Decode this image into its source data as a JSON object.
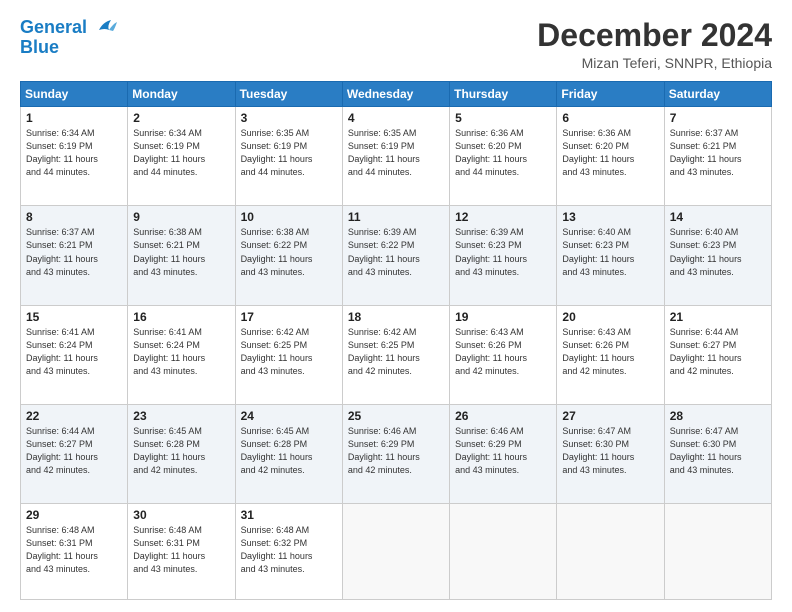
{
  "header": {
    "logo_line1": "General",
    "logo_line2": "Blue",
    "month": "December 2024",
    "location": "Mizan Teferi, SNNPR, Ethiopia"
  },
  "days_of_week": [
    "Sunday",
    "Monday",
    "Tuesday",
    "Wednesday",
    "Thursday",
    "Friday",
    "Saturday"
  ],
  "weeks": [
    [
      {
        "day": "1",
        "info": "Sunrise: 6:34 AM\nSunset: 6:19 PM\nDaylight: 11 hours\nand 44 minutes."
      },
      {
        "day": "2",
        "info": "Sunrise: 6:34 AM\nSunset: 6:19 PM\nDaylight: 11 hours\nand 44 minutes."
      },
      {
        "day": "3",
        "info": "Sunrise: 6:35 AM\nSunset: 6:19 PM\nDaylight: 11 hours\nand 44 minutes."
      },
      {
        "day": "4",
        "info": "Sunrise: 6:35 AM\nSunset: 6:19 PM\nDaylight: 11 hours\nand 44 minutes."
      },
      {
        "day": "5",
        "info": "Sunrise: 6:36 AM\nSunset: 6:20 PM\nDaylight: 11 hours\nand 44 minutes."
      },
      {
        "day": "6",
        "info": "Sunrise: 6:36 AM\nSunset: 6:20 PM\nDaylight: 11 hours\nand 43 minutes."
      },
      {
        "day": "7",
        "info": "Sunrise: 6:37 AM\nSunset: 6:21 PM\nDaylight: 11 hours\nand 43 minutes."
      }
    ],
    [
      {
        "day": "8",
        "info": "Sunrise: 6:37 AM\nSunset: 6:21 PM\nDaylight: 11 hours\nand 43 minutes."
      },
      {
        "day": "9",
        "info": "Sunrise: 6:38 AM\nSunset: 6:21 PM\nDaylight: 11 hours\nand 43 minutes."
      },
      {
        "day": "10",
        "info": "Sunrise: 6:38 AM\nSunset: 6:22 PM\nDaylight: 11 hours\nand 43 minutes."
      },
      {
        "day": "11",
        "info": "Sunrise: 6:39 AM\nSunset: 6:22 PM\nDaylight: 11 hours\nand 43 minutes."
      },
      {
        "day": "12",
        "info": "Sunrise: 6:39 AM\nSunset: 6:23 PM\nDaylight: 11 hours\nand 43 minutes."
      },
      {
        "day": "13",
        "info": "Sunrise: 6:40 AM\nSunset: 6:23 PM\nDaylight: 11 hours\nand 43 minutes."
      },
      {
        "day": "14",
        "info": "Sunrise: 6:40 AM\nSunset: 6:23 PM\nDaylight: 11 hours\nand 43 minutes."
      }
    ],
    [
      {
        "day": "15",
        "info": "Sunrise: 6:41 AM\nSunset: 6:24 PM\nDaylight: 11 hours\nand 43 minutes."
      },
      {
        "day": "16",
        "info": "Sunrise: 6:41 AM\nSunset: 6:24 PM\nDaylight: 11 hours\nand 43 minutes."
      },
      {
        "day": "17",
        "info": "Sunrise: 6:42 AM\nSunset: 6:25 PM\nDaylight: 11 hours\nand 43 minutes."
      },
      {
        "day": "18",
        "info": "Sunrise: 6:42 AM\nSunset: 6:25 PM\nDaylight: 11 hours\nand 42 minutes."
      },
      {
        "day": "19",
        "info": "Sunrise: 6:43 AM\nSunset: 6:26 PM\nDaylight: 11 hours\nand 42 minutes."
      },
      {
        "day": "20",
        "info": "Sunrise: 6:43 AM\nSunset: 6:26 PM\nDaylight: 11 hours\nand 42 minutes."
      },
      {
        "day": "21",
        "info": "Sunrise: 6:44 AM\nSunset: 6:27 PM\nDaylight: 11 hours\nand 42 minutes."
      }
    ],
    [
      {
        "day": "22",
        "info": "Sunrise: 6:44 AM\nSunset: 6:27 PM\nDaylight: 11 hours\nand 42 minutes."
      },
      {
        "day": "23",
        "info": "Sunrise: 6:45 AM\nSunset: 6:28 PM\nDaylight: 11 hours\nand 42 minutes."
      },
      {
        "day": "24",
        "info": "Sunrise: 6:45 AM\nSunset: 6:28 PM\nDaylight: 11 hours\nand 42 minutes."
      },
      {
        "day": "25",
        "info": "Sunrise: 6:46 AM\nSunset: 6:29 PM\nDaylight: 11 hours\nand 42 minutes."
      },
      {
        "day": "26",
        "info": "Sunrise: 6:46 AM\nSunset: 6:29 PM\nDaylight: 11 hours\nand 43 minutes."
      },
      {
        "day": "27",
        "info": "Sunrise: 6:47 AM\nSunset: 6:30 PM\nDaylight: 11 hours\nand 43 minutes."
      },
      {
        "day": "28",
        "info": "Sunrise: 6:47 AM\nSunset: 6:30 PM\nDaylight: 11 hours\nand 43 minutes."
      }
    ],
    [
      {
        "day": "29",
        "info": "Sunrise: 6:48 AM\nSunset: 6:31 PM\nDaylight: 11 hours\nand 43 minutes."
      },
      {
        "day": "30",
        "info": "Sunrise: 6:48 AM\nSunset: 6:31 PM\nDaylight: 11 hours\nand 43 minutes."
      },
      {
        "day": "31",
        "info": "Sunrise: 6:48 AM\nSunset: 6:32 PM\nDaylight: 11 hours\nand 43 minutes."
      },
      {
        "day": "",
        "info": ""
      },
      {
        "day": "",
        "info": ""
      },
      {
        "day": "",
        "info": ""
      },
      {
        "day": "",
        "info": ""
      }
    ]
  ]
}
